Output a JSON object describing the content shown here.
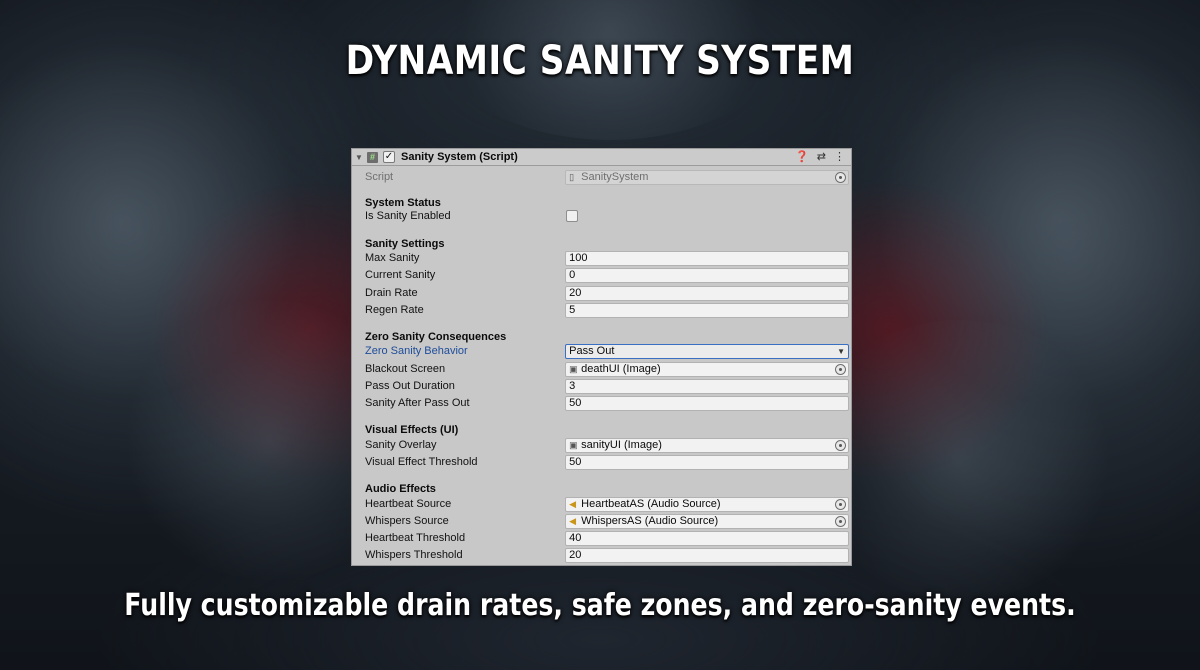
{
  "headline": "DYNAMIC SANITY SYSTEM",
  "caption": "Fully customizable drain rates, safe zones, and zero-sanity events.",
  "component": {
    "title": "Sanity System (Script)",
    "enabled": true,
    "icons": {
      "help": "question-icon",
      "presets": "sliders-icon",
      "more": "kebab-icon"
    }
  },
  "script_row": {
    "label": "Script",
    "value": "SanitySystem"
  },
  "sections": {
    "system_status": "System Status",
    "sanity_settings": "Sanity Settings",
    "zero_consequences": "Zero Sanity Consequences",
    "visual_effects": "Visual Effects (UI)",
    "audio_effects": "Audio Effects"
  },
  "fields": {
    "is_sanity_enabled": {
      "label": "Is Sanity Enabled",
      "checked": false
    },
    "max_sanity": {
      "label": "Max Sanity",
      "value": "100"
    },
    "current_sanity": {
      "label": "Current Sanity",
      "value": "0"
    },
    "drain_rate": {
      "label": "Drain Rate",
      "value": "20"
    },
    "regen_rate": {
      "label": "Regen Rate",
      "value": "5"
    },
    "zero_behavior": {
      "label": "Zero Sanity Behavior",
      "value": "Pass Out"
    },
    "blackout_screen": {
      "label": "Blackout Screen",
      "value": "deathUI (Image)"
    },
    "pass_out_duration": {
      "label": "Pass Out Duration",
      "value": "3"
    },
    "sanity_after_pass_out": {
      "label": "Sanity After Pass Out",
      "value": "50"
    },
    "sanity_overlay": {
      "label": "Sanity Overlay",
      "value": "sanityUI (Image)"
    },
    "visual_effect_threshold": {
      "label": "Visual Effect Threshold",
      "value": "50"
    },
    "heartbeat_source": {
      "label": "Heartbeat Source",
      "value": "HeartbeatAS (Audio Source)"
    },
    "whispers_source": {
      "label": "Whispers Source",
      "value": "WhispersAS (Audio Source)"
    },
    "heartbeat_threshold": {
      "label": "Heartbeat Threshold",
      "value": "40"
    },
    "whispers_threshold": {
      "label": "Whispers Threshold",
      "value": "20"
    }
  },
  "colors": {
    "inspector_bg": "#c8c8c8",
    "field_bg": "#f2f2f2",
    "link_label": "#1e4d9b",
    "audio_icon": "#c9961a"
  }
}
